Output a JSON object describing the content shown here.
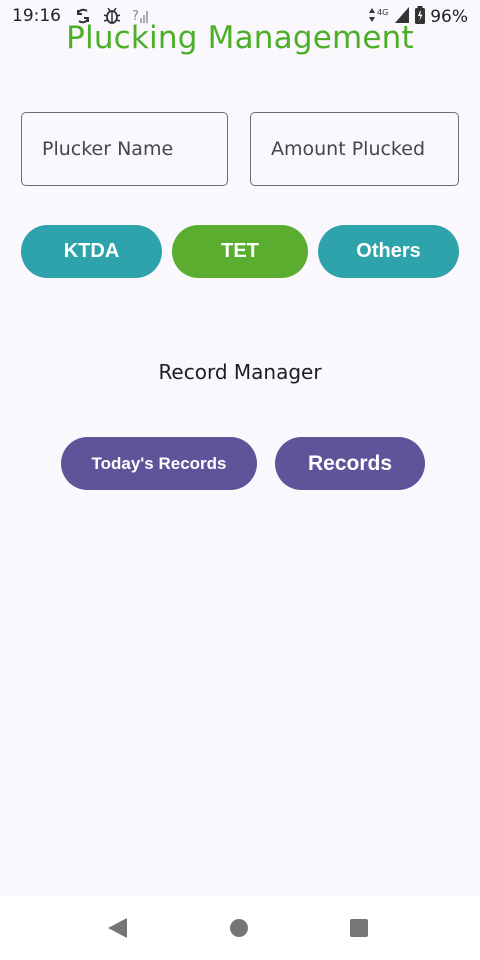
{
  "status_bar": {
    "time": "19:16",
    "network_label": "4G",
    "battery_percent": "96%"
  },
  "app": {
    "title": "Plucking Management"
  },
  "form": {
    "plucker_name_placeholder": "Plucker Name",
    "amount_placeholder": "Amount Plucked"
  },
  "categories": {
    "ktda_label": "KTDA",
    "tet_label": "TET",
    "others_label": "Others"
  },
  "record_manager": {
    "heading": "Record Manager",
    "todays_records_label": "Today's Records",
    "records_label": "Records"
  },
  "colors": {
    "title_green": "#4CAF28",
    "teal_button": "#2FA3AB",
    "green_button": "#5AAD2E",
    "purple_button": "#5E5499",
    "background": "#FAF7FD"
  },
  "icons": [
    "signal-icon",
    "bug-icon",
    "wifi-question-icon",
    "data-arrows-icon",
    "cell-signal-icon",
    "battery-icon",
    "back-icon",
    "home-icon",
    "recents-icon"
  ]
}
